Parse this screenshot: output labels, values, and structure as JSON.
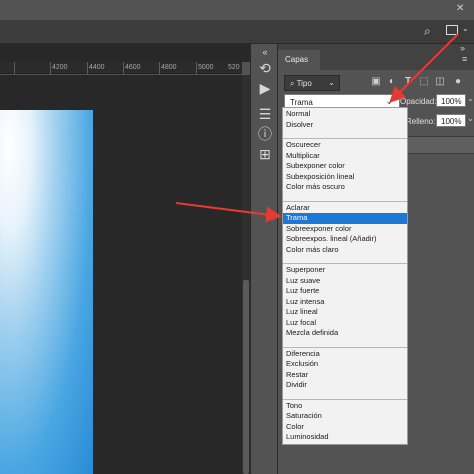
{
  "ruler": {
    "labels": [
      "4200",
      "4400",
      "4600",
      "4800",
      "5000",
      "520"
    ]
  },
  "panel": {
    "tab_label": "Capas",
    "filter_label": "Tipo",
    "blend_mode": "Trama",
    "opacity_label": "Opacidad:",
    "opacity_value": "100%",
    "fill_label": "Relleno:",
    "fill_value": "100%"
  },
  "blend_menu": {
    "sections": [
      {
        "items": [
          "Normal",
          "Disolver"
        ]
      },
      {
        "items": [
          "Oscurecer",
          "Multiplicar",
          "Subexponer color",
          "Subexposición lineal",
          "Color más oscuro"
        ]
      },
      {
        "items": [
          "Aclarar",
          "Trama",
          "Sobreexponer color",
          "Sobreexpos. lineal (Añadir)",
          "Color más claro"
        ]
      },
      {
        "items": [
          "Superponer",
          "Luz suave",
          "Luz fuerte",
          "Luz intensa",
          "Luz lineal",
          "Luz focal",
          "Mezcla definida"
        ]
      },
      {
        "items": [
          "Diferencia",
          "Exclusión",
          "Restar",
          "Dividir"
        ]
      },
      {
        "items": [
          "Tono",
          "Saturación",
          "Color",
          "Luminosidad"
        ]
      }
    ],
    "selected": "Trama"
  },
  "colors": {
    "accent": "#1e78d6",
    "annotation": "#e53935",
    "panel": "#535353"
  }
}
